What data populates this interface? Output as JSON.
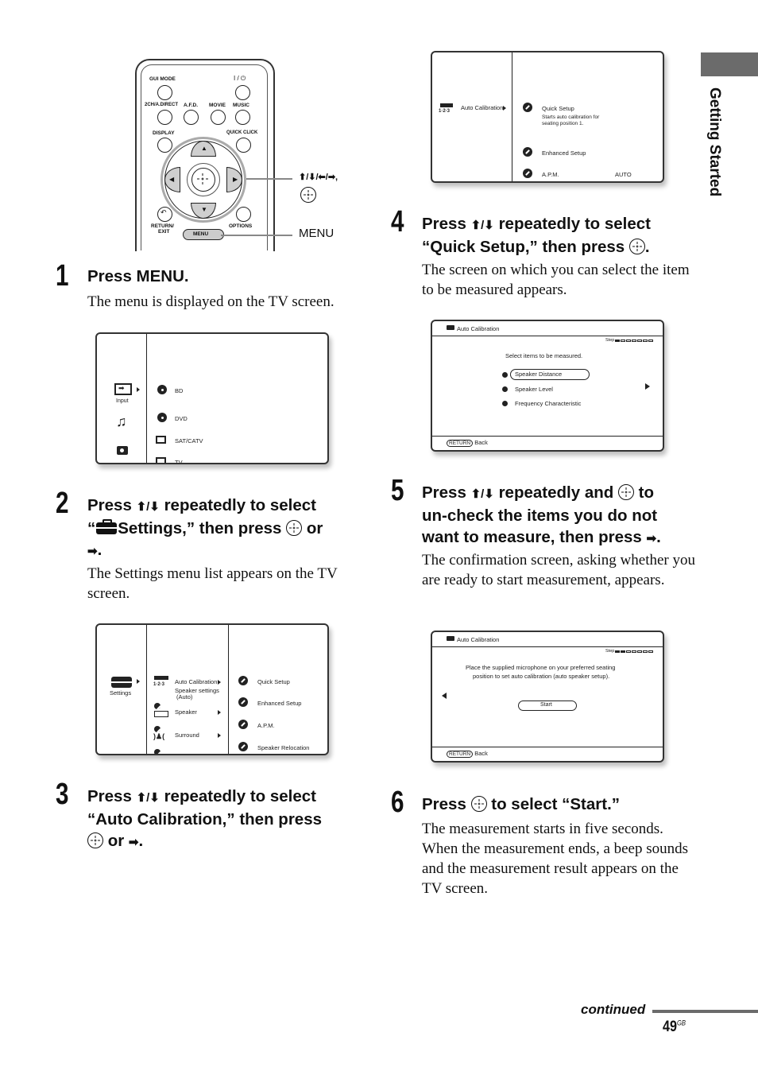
{
  "side_tab": {
    "label": "Getting Started",
    "color": "#6b6b6b"
  },
  "remote": {
    "buttons": {
      "gui_mode": "GUI MODE",
      "power": "I / ⏻",
      "two_ch": "2CH/A.DIRECT",
      "afd": "A.F.D.",
      "movie": "MOVIE",
      "music": "MUSIC",
      "display": "DISPLAY",
      "quick_click": "QUICK CLICK",
      "return_exit_1": "RETURN/",
      "return_exit_2": "EXIT",
      "options": "OPTIONS",
      "menu": "MENU"
    },
    "callouts": {
      "arrows": "⬆/⬇/⬅/➡,",
      "menu": "MENU"
    }
  },
  "steps": [
    {
      "number": "1",
      "heading": "Press MENU.",
      "body": "The menu is displayed on the TV screen."
    },
    {
      "number": "2",
      "heading_parts": [
        "Press ",
        "⬆/⬇",
        " repeatedly to select",
        "“",
        "Settings,” then press ",
        " or",
        "➡",
        "."
      ],
      "body": "The Settings menu list appears on the TV screen."
    },
    {
      "number": "3",
      "heading_parts": [
        "Press ",
        "⬆/⬇",
        " repeatedly to select",
        "“Auto Calibration,” then press",
        " or ",
        "➡",
        "."
      ]
    },
    {
      "number": "4",
      "heading_parts": [
        "Press ",
        "⬆/⬇",
        " repeatedly to select",
        "“Quick Setup,” then press ",
        "."
      ],
      "body": "The screen on which you can select the item to be measured appears."
    },
    {
      "number": "5",
      "heading_parts": [
        "Press ",
        "⬆/⬇",
        " repeatedly and ",
        " to",
        "un-check the items you do not",
        "want to measure, then press ",
        "➡",
        "."
      ],
      "body": "The confirmation screen, asking whether you are ready to start measurement, appears."
    },
    {
      "number": "6",
      "heading_parts": [
        "Press ",
        " to select “Start.”"
      ],
      "body": "The measurement starts in five seconds. When the measurement ends, a beep sounds and the measurement result appears on the TV screen."
    }
  ],
  "screens": {
    "menu": {
      "category": "Input",
      "items": [
        "BD",
        "DVD",
        "SAT/CATV",
        "TV"
      ]
    },
    "settings": {
      "category": "Settings",
      "col2": {
        "auto_cal": "Auto Calibration",
        "auto_cal_sub1": "Speaker settings",
        "auto_cal_sub2": "(Auto)",
        "auto_cal_icon_label": "1·2·3",
        "speaker": "Speaker",
        "surround": "Surround"
      },
      "col3": [
        "Quick Setup",
        "Enhanced Setup",
        "A.P.M.",
        "Speaker Relocation"
      ]
    },
    "auto_cal": {
      "left": "Auto Calibration",
      "icon_label": "1·2·3",
      "quick_setup": "Quick Setup",
      "quick_desc1": "Starts auto calibration for",
      "quick_desc2": "seating position 1.",
      "enhanced": "Enhanced Setup",
      "apm": "A.P.M.",
      "apm_value": "AUTO"
    },
    "select_items": {
      "title": "Auto Calibration",
      "step_label": "Step",
      "step_current": 1,
      "step_total": 7,
      "prompt": "Select items to be measured.",
      "items": [
        {
          "label": "Speaker Distance",
          "checked": true,
          "selected": true
        },
        {
          "label": "Speaker Level",
          "checked": true,
          "selected": false
        },
        {
          "label": "Frequency Characteristic",
          "checked": true,
          "selected": false
        }
      ],
      "return_key": "RETURN",
      "back": "Back"
    },
    "confirm": {
      "title": "Auto Calibration",
      "step_label": "Step",
      "step_current": 2,
      "step_total": 7,
      "message1": "Place the supplied microphone on your preferred seating",
      "message2": "position to set auto calibration (auto speaker setup).",
      "start": "Start",
      "return_key": "RETURN",
      "back": "Back"
    }
  },
  "footer": {
    "continued": "continued",
    "page": "49",
    "page_suffix": "GB"
  }
}
